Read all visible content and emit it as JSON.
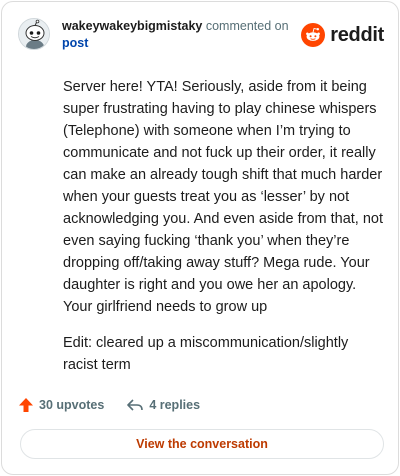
{
  "header": {
    "username": "wakeywakeybigmistaky",
    "action_text": "commented on",
    "post_link": "post",
    "avatar_icon": "snoo-avatar-icon",
    "logo_icon": "reddit-snoo-icon",
    "logo_text": "reddit"
  },
  "comment": {
    "paragraphs": [
      "Server here! YTA! Seriously, aside from it being super frustrating having to play chinese whispers (Telephone) with someone when I’m trying to communicate and not fuck up their order, it really can make an already tough shift that much harder when your guests treat you as ‘lesser’ by not acknowledging you. And even aside from that, not even saying fucking ‘thank you’ when they’re dropping off/taking away stuff? Mega rude. Your daughter is right and you owe her an apology. Your girlfriend needs to grow up",
      "Edit: cleared up a miscommunication/slightly racist term"
    ]
  },
  "footer": {
    "upvotes": "30 upvotes",
    "replies": "4 replies",
    "upvote_icon": "upvote-arrow-icon",
    "reply_icon": "reply-arrow-icon"
  },
  "cta": {
    "label": "View the conversation"
  },
  "colors": {
    "brand": "#ff4500",
    "link": "#0045ac",
    "cta_text": "#bd3a00",
    "muted": "#576f76"
  }
}
